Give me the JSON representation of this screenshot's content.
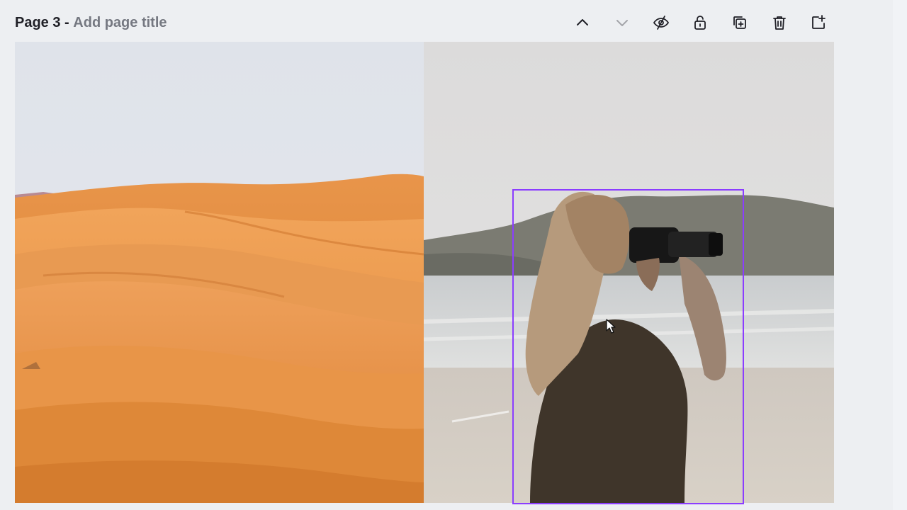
{
  "page": {
    "label": "Page 3",
    "separator": "-",
    "title_placeholder": "Add page title"
  },
  "toolbar": {
    "move_up": "chevron-up-icon",
    "move_down": "chevron-down-icon",
    "hide": "eye-slash-icon",
    "lock": "unlock-icon",
    "duplicate": "duplicate-page-icon",
    "delete": "trash-icon",
    "add": "add-page-icon"
  },
  "canvas": {
    "images": [
      {
        "name": "desert-dunes-photo"
      },
      {
        "name": "photographer-on-beach-photo"
      }
    ],
    "selection_color": "#8b3dff"
  }
}
